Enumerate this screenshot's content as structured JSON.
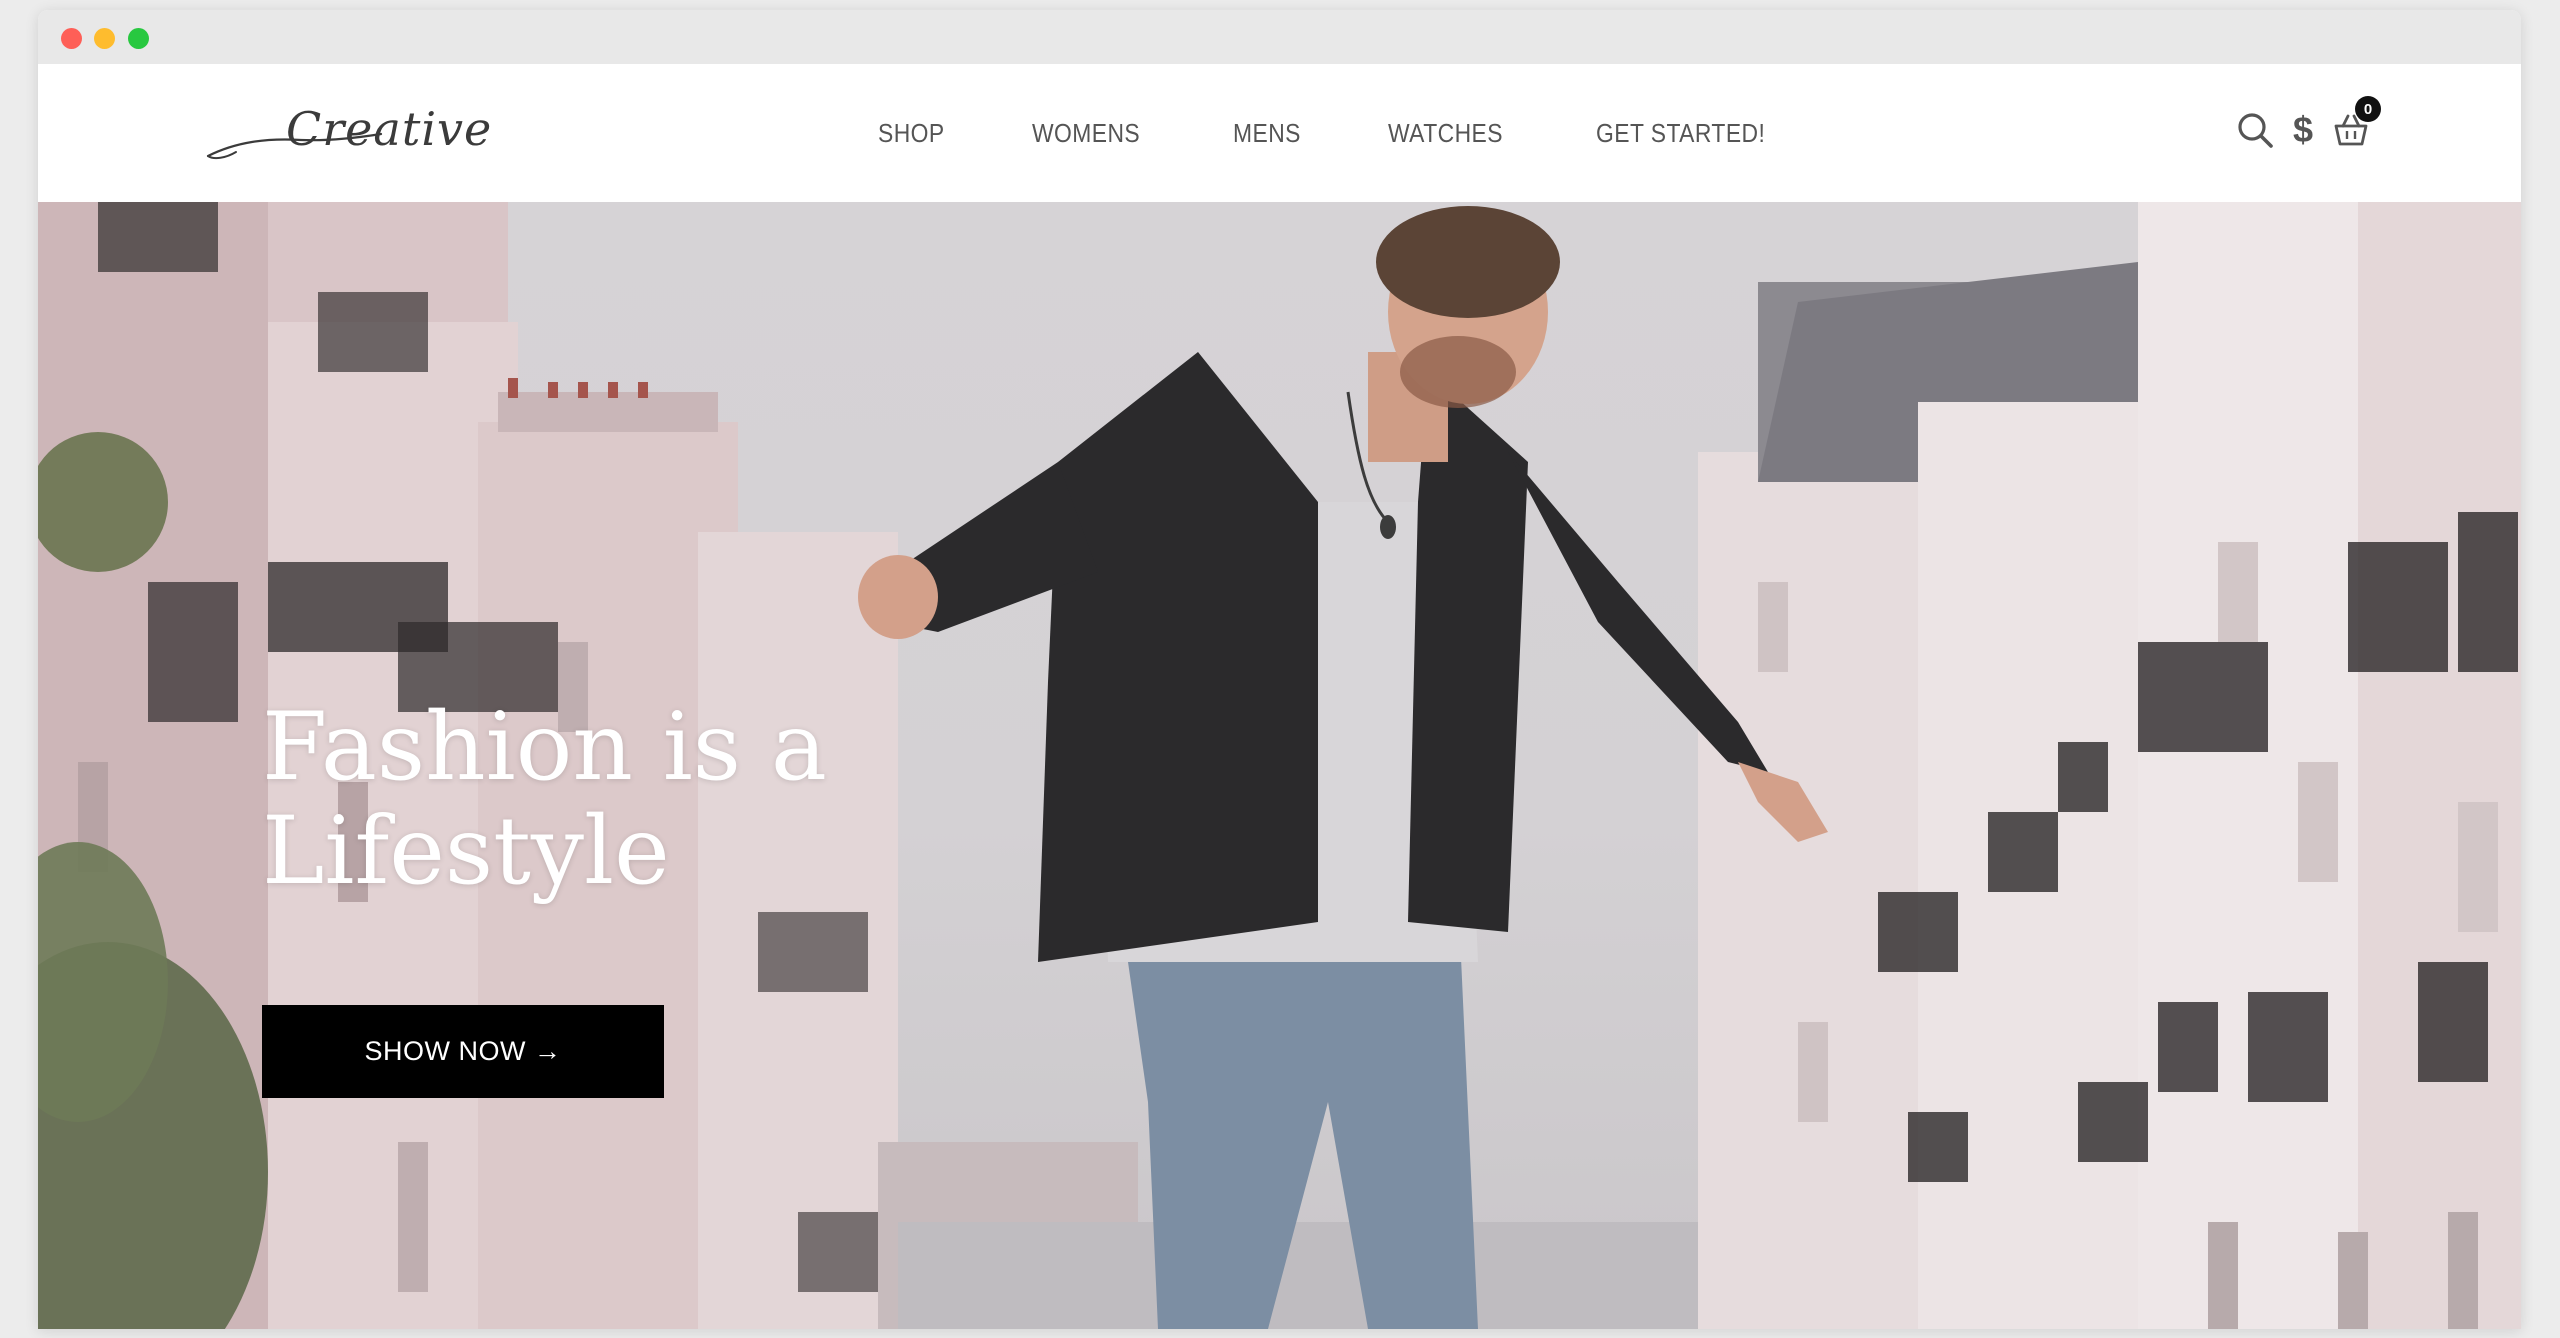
{
  "window": {
    "controls": [
      "close",
      "minimize",
      "maximize"
    ]
  },
  "logo": {
    "text": "Creative"
  },
  "nav": {
    "items": [
      {
        "label": "SHOP"
      },
      {
        "label": "WOMENS"
      },
      {
        "label": "MENS"
      },
      {
        "label": "WATCHES"
      },
      {
        "label": "GET STARTED!"
      }
    ]
  },
  "header_icons": {
    "search": "search-icon",
    "currency_symbol": "$",
    "cart": "basket-icon",
    "cart_count": "0"
  },
  "hero": {
    "title_line1": "Fashion is a",
    "title_line2": "Lifestyle",
    "button_label": "SHOW NOW →"
  },
  "colors": {
    "button_bg": "#000000",
    "button_text": "#ffffff",
    "nav_text": "#555555",
    "badge_bg": "#111111"
  }
}
